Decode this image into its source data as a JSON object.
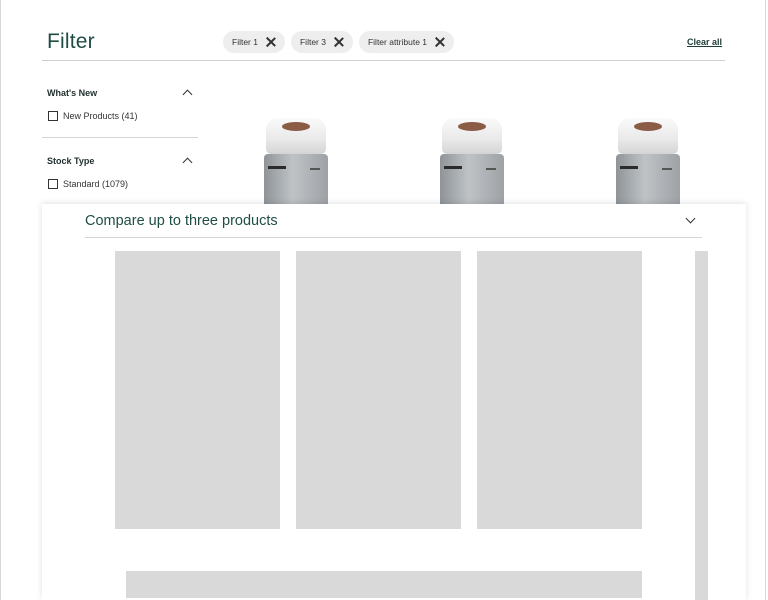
{
  "header": {
    "title": "Filter",
    "chips": [
      {
        "label": "Filter 1"
      },
      {
        "label": "Filter 3"
      },
      {
        "label": "Filter attribute 1"
      }
    ],
    "clear_all": "Clear all"
  },
  "facets": [
    {
      "title": "What's New",
      "options": [
        {
          "label": "New Products (41)",
          "checked": false
        }
      ]
    },
    {
      "title": "Stock Type",
      "options": [
        {
          "label": "Standard (1079)",
          "checked": false
        }
      ]
    }
  ],
  "compare": {
    "title": "Compare up to three products"
  },
  "icons": {
    "chip_remove": "close-icon",
    "facet_toggle": "chevron-up-icon",
    "compare_toggle": "chevron-down-icon"
  },
  "colors": {
    "brand_green": "#1f4d45",
    "chip_bg": "#eeeeee",
    "placeholder_gray": "#d9d9d9"
  }
}
